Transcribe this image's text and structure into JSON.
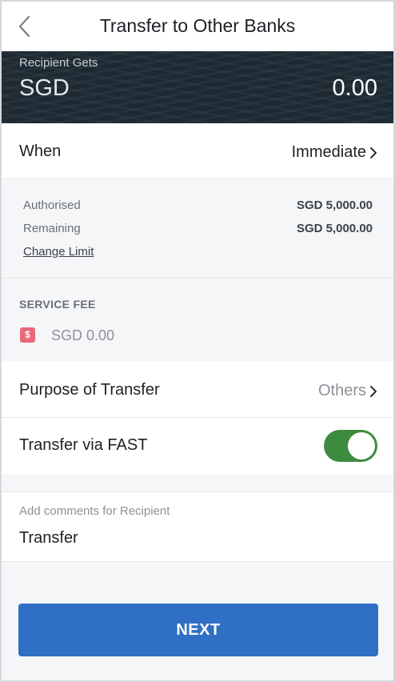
{
  "header": {
    "title": "Transfer to Other Banks",
    "back_icon": "chevron-left-icon"
  },
  "recipient": {
    "label": "Recipient Gets",
    "currency": "SGD",
    "amount": "0.00"
  },
  "when": {
    "label": "When",
    "value": "Immediate"
  },
  "limits": {
    "authorised_label": "Authorised",
    "authorised_value": "SGD 5,000.00",
    "remaining_label": "Remaining",
    "remaining_value": "SGD 5,000.00",
    "change_limit": "Change Limit"
  },
  "service_fee": {
    "title": "SERVICE FEE",
    "icon": "$",
    "value": "SGD 0.00"
  },
  "purpose": {
    "label": "Purpose of Transfer",
    "value": "Others"
  },
  "fast": {
    "label": "Transfer via FAST",
    "enabled": true,
    "toggle_color": "#3d8b3f"
  },
  "comments": {
    "placeholder": "Add comments for Recipient",
    "value": "Transfer"
  },
  "actions": {
    "next_label": "NEXT",
    "button_color": "#2f70c4"
  }
}
